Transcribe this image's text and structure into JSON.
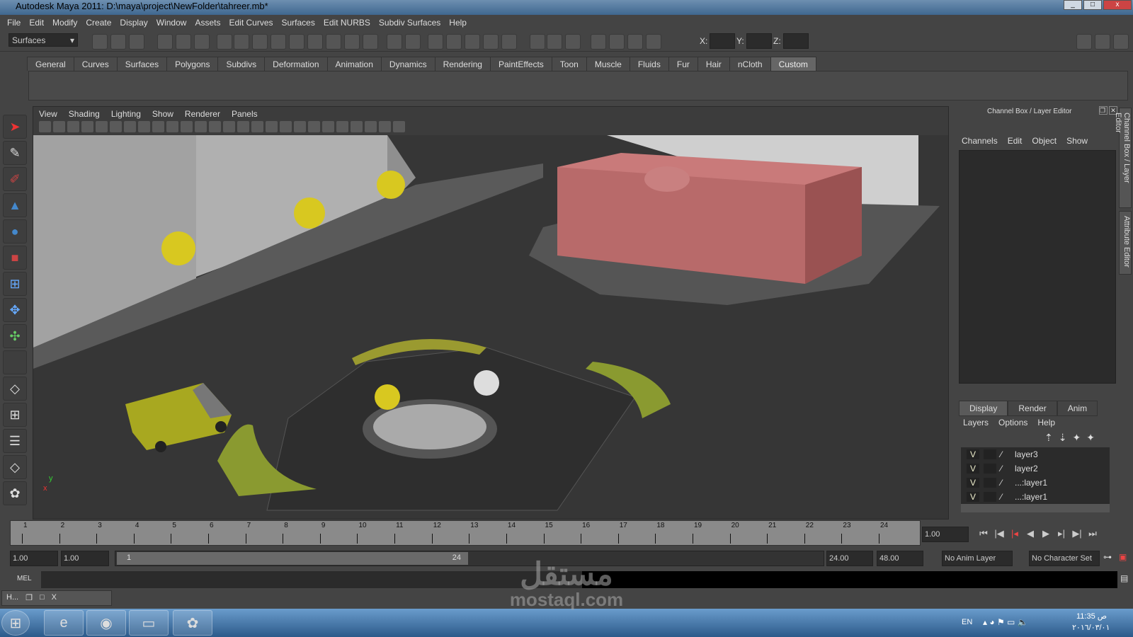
{
  "window": {
    "title": "Autodesk Maya 2011: D:\\maya\\project\\NewFolder\\tahreer.mb*"
  },
  "menubar": [
    "File",
    "Edit",
    "Modify",
    "Create",
    "Display",
    "Window",
    "Assets",
    "Edit Curves",
    "Surfaces",
    "Edit NURBS",
    "Subdiv Surfaces",
    "Help"
  ],
  "toolbar": {
    "menu_set": "Surfaces",
    "x_label": "X:",
    "y_label": "Y:",
    "z_label": "Z:"
  },
  "shelf": {
    "tabs": [
      "General",
      "Curves",
      "Surfaces",
      "Polygons",
      "Subdivs",
      "Deformation",
      "Animation",
      "Dynamics",
      "Rendering",
      "PaintEffects",
      "Toon",
      "Muscle",
      "Fluids",
      "Fur",
      "Hair",
      "nCloth",
      "Custom"
    ],
    "active": "Custom"
  },
  "viewport": {
    "menus": [
      "View",
      "Shading",
      "Lighting",
      "Show",
      "Renderer",
      "Panels"
    ],
    "axis_x": "x",
    "axis_y": "y"
  },
  "channel_box": {
    "title": "Channel Box / Layer Editor",
    "menus": [
      "Channels",
      "Edit",
      "Object",
      "Show"
    ]
  },
  "layer_editor": {
    "tabs": [
      "Display",
      "Render",
      "Anim"
    ],
    "active_tab": "Display",
    "menus": [
      "Layers",
      "Options",
      "Help"
    ],
    "layers": [
      {
        "v": "V",
        "name": "layer3"
      },
      {
        "v": "V",
        "name": "layer2"
      },
      {
        "v": "V",
        "name": "...:layer1"
      },
      {
        "v": "V",
        "name": "...:layer1"
      }
    ]
  },
  "side_tabs": [
    "Channel Box / Layer Editor",
    "Attribute Editor"
  ],
  "timeline": {
    "ticks": [
      "1",
      "2",
      "3",
      "4",
      "5",
      "6",
      "7",
      "8",
      "9",
      "10",
      "11",
      "12",
      "13",
      "14",
      "15",
      "16",
      "17",
      "18",
      "19",
      "20",
      "21",
      "22",
      "23",
      "24"
    ],
    "current_frame": "1.00"
  },
  "range": {
    "start": "1.00",
    "playback_start": "1.00",
    "slider_start": "1",
    "slider_end": "24",
    "playback_end": "24.00",
    "end": "48.00",
    "anim_layer": "No Anim Layer",
    "character_set": "No Character Set"
  },
  "command_line": {
    "label": "MEL"
  },
  "minimized_window": {
    "label": "H..."
  },
  "taskbar": {
    "lang": "EN",
    "time": "11:35 ص",
    "date": "٢٠١٦/٠٣/٠١"
  },
  "watermark": {
    "arabic": "مستقل",
    "latin": "mostaql.com"
  }
}
